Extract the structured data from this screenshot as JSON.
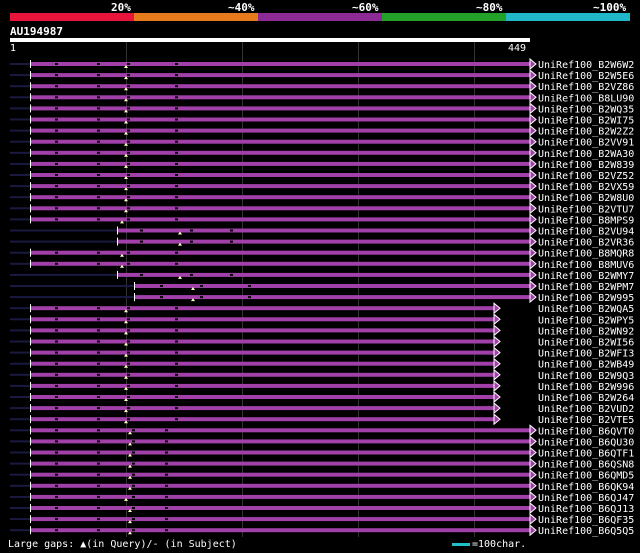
{
  "legend": [
    {
      "label": "20%",
      "color": "#e8143c"
    },
    {
      "label": "~40%",
      "color": "#e87a1e"
    },
    {
      "label": "~60%",
      "color": "#8c2a96"
    },
    {
      "label": "~80%",
      "color": "#22a02a"
    },
    {
      "label": "~100%",
      "color": "#20b8c8"
    }
  ],
  "query": {
    "title": "AU194987",
    "start": "1",
    "end": "449",
    "length": 449
  },
  "hit_color": "#a040a8",
  "gap_color": "#1a1a40",
  "hits": [
    {
      "name": "UniRef100_B2W6W2",
      "start": 30,
      "end": 530,
      "ins": [
        126
      ],
      "breaks": [
        55,
        97,
        127,
        175
      ]
    },
    {
      "name": "UniRef100_B2W5E6",
      "start": 30,
      "end": 530,
      "ins": [
        126
      ],
      "breaks": [
        55,
        97,
        127,
        175
      ]
    },
    {
      "name": "UniRef100_B2VZ86",
      "start": 30,
      "end": 530,
      "ins": [
        126
      ],
      "breaks": [
        55,
        97,
        127,
        175
      ]
    },
    {
      "name": "UniRef100_B8LU90",
      "start": 30,
      "end": 530,
      "ins": [
        126
      ],
      "breaks": [
        55,
        97,
        127,
        175
      ]
    },
    {
      "name": "UniRef100_B2WQ35",
      "start": 30,
      "end": 530,
      "ins": [
        126
      ],
      "breaks": [
        55,
        97,
        127,
        175
      ]
    },
    {
      "name": "UniRef100_B2WI75",
      "start": 30,
      "end": 530,
      "ins": [
        126
      ],
      "breaks": [
        55,
        97,
        127,
        175
      ]
    },
    {
      "name": "UniRef100_B2W2Z2",
      "start": 30,
      "end": 530,
      "ins": [
        126
      ],
      "breaks": [
        55,
        97,
        127,
        175
      ]
    },
    {
      "name": "UniRef100_B2VV91",
      "start": 30,
      "end": 530,
      "ins": [
        126
      ],
      "breaks": [
        55,
        97,
        127,
        175
      ]
    },
    {
      "name": "UniRef100_B2WA30",
      "start": 30,
      "end": 530,
      "ins": [
        126
      ],
      "breaks": [
        55,
        97,
        127,
        175
      ]
    },
    {
      "name": "UniRef100_B2W839",
      "start": 30,
      "end": 530,
      "ins": [
        126
      ],
      "breaks": [
        55,
        97,
        127,
        175
      ]
    },
    {
      "name": "UniRef100_B2VZ52",
      "start": 30,
      "end": 530,
      "ins": [
        126
      ],
      "breaks": [
        55,
        97,
        127,
        175
      ]
    },
    {
      "name": "UniRef100_B2VX59",
      "start": 30,
      "end": 530,
      "ins": [
        126
      ],
      "breaks": [
        55,
        97,
        127,
        175
      ]
    },
    {
      "name": "UniRef100_B2W8U0",
      "start": 30,
      "end": 530,
      "ins": [
        126
      ],
      "breaks": [
        55,
        97,
        127,
        175
      ]
    },
    {
      "name": "UniRef100_B2VTU7",
      "start": 30,
      "end": 530,
      "ins": [
        126
      ],
      "breaks": [
        55,
        97,
        127,
        175
      ]
    },
    {
      "name": "UniRef100_B8MPS9",
      "start": 30,
      "end": 530,
      "ins": [
        122
      ],
      "breaks": [
        55,
        97,
        127,
        175
      ]
    },
    {
      "name": "UniRef100_B2VU94",
      "start": 117,
      "end": 530,
      "ins": [
        180
      ],
      "breaks": [
        140,
        190,
        230
      ]
    },
    {
      "name": "UniRef100_B2VR36",
      "start": 117,
      "end": 530,
      "ins": [
        180
      ],
      "breaks": [
        140,
        190,
        230
      ]
    },
    {
      "name": "UniRef100_B8MQR8",
      "start": 30,
      "end": 530,
      "ins": [
        122
      ],
      "breaks": [
        55,
        97,
        127,
        175
      ]
    },
    {
      "name": "UniRef100_B8MUV6",
      "start": 30,
      "end": 530,
      "ins": [
        122
      ],
      "breaks": [
        55,
        97,
        127,
        175
      ]
    },
    {
      "name": "UniRef100_B2WMY7",
      "start": 117,
      "end": 530,
      "ins": [
        180
      ],
      "breaks": [
        140,
        190,
        230
      ]
    },
    {
      "name": "UniRef100_B2WPM7",
      "start": 134,
      "end": 530,
      "ins": [
        193
      ],
      "breaks": [
        160,
        200,
        248
      ]
    },
    {
      "name": "UniRef100_B2W995",
      "start": 134,
      "end": 530,
      "ins": [
        193
      ],
      "breaks": [
        160,
        200,
        248
      ]
    },
    {
      "name": "UniRef100_B2WQA5",
      "start": 30,
      "end": 494,
      "ins": [
        126
      ],
      "breaks": [
        55,
        97,
        127,
        175
      ]
    },
    {
      "name": "UniRef100_B2WPY5",
      "start": 30,
      "end": 494,
      "ins": [
        126
      ],
      "breaks": [
        55,
        97,
        127,
        175
      ]
    },
    {
      "name": "UniRef100_B2WN92",
      "start": 30,
      "end": 494,
      "ins": [
        126
      ],
      "breaks": [
        55,
        97,
        127,
        175
      ]
    },
    {
      "name": "UniRef100_B2WI56",
      "start": 30,
      "end": 494,
      "ins": [
        126
      ],
      "breaks": [
        55,
        97,
        127,
        175
      ]
    },
    {
      "name": "UniRef100_B2WFI3",
      "start": 30,
      "end": 494,
      "ins": [
        126
      ],
      "breaks": [
        55,
        97,
        127,
        175
      ]
    },
    {
      "name": "UniRef100_B2WB49",
      "start": 30,
      "end": 494,
      "ins": [
        126
      ],
      "breaks": [
        55,
        97,
        127,
        175
      ]
    },
    {
      "name": "UniRef100_B2W9Q3",
      "start": 30,
      "end": 494,
      "ins": [
        126
      ],
      "breaks": [
        55,
        97,
        127,
        175
      ]
    },
    {
      "name": "UniRef100_B2W996",
      "start": 30,
      "end": 494,
      "ins": [
        126
      ],
      "breaks": [
        55,
        97,
        127,
        175
      ]
    },
    {
      "name": "UniRef100_B2W264",
      "start": 30,
      "end": 494,
      "ins": [
        126
      ],
      "breaks": [
        55,
        97,
        127,
        175
      ]
    },
    {
      "name": "UniRef100_B2VUD2",
      "start": 30,
      "end": 494,
      "ins": [
        126
      ],
      "breaks": [
        55,
        97,
        127,
        175
      ]
    },
    {
      "name": "UniRef100_B2VTE5",
      "start": 30,
      "end": 494,
      "ins": [
        126
      ],
      "breaks": [
        55,
        97,
        127,
        175
      ]
    },
    {
      "name": "UniRef100_B6QVT0",
      "start": 30,
      "end": 530,
      "ins": [
        130
      ],
      "breaks": [
        55,
        97,
        132,
        165
      ]
    },
    {
      "name": "UniRef100_B6QU30",
      "start": 30,
      "end": 530,
      "ins": [
        130
      ],
      "breaks": [
        55,
        97,
        132,
        165
      ]
    },
    {
      "name": "UniRef100_B6QTF1",
      "start": 30,
      "end": 530,
      "ins": [
        130
      ],
      "breaks": [
        55,
        97,
        132,
        165
      ]
    },
    {
      "name": "UniRef100_B6QSN8",
      "start": 30,
      "end": 530,
      "ins": [
        130
      ],
      "breaks": [
        55,
        97,
        132,
        165
      ]
    },
    {
      "name": "UniRef100_B6QMD5",
      "start": 30,
      "end": 530,
      "ins": [
        130
      ],
      "breaks": [
        55,
        97,
        132,
        165
      ]
    },
    {
      "name": "UniRef100_B6QK94",
      "start": 30,
      "end": 530,
      "ins": [
        130
      ],
      "breaks": [
        55,
        97,
        132,
        165
      ]
    },
    {
      "name": "UniRef100_B6QJ47",
      "start": 30,
      "end": 530,
      "ins": [
        126
      ],
      "breaks": [
        55,
        97,
        132,
        165
      ]
    },
    {
      "name": "UniRef100_B6QJ13",
      "start": 30,
      "end": 530,
      "ins": [
        130
      ],
      "breaks": [
        55,
        97,
        132,
        165
      ]
    },
    {
      "name": "UniRef100_B6QF35",
      "start": 30,
      "end": 530,
      "ins": [
        130
      ],
      "breaks": [
        55,
        97,
        132,
        165
      ]
    },
    {
      "name": "UniRef100_B6Q5Q5",
      "start": 30,
      "end": 530,
      "ins": [
        130
      ],
      "breaks": [
        55,
        97,
        132,
        165
      ]
    }
  ],
  "footer": {
    "large_gaps": "Large gaps: ▲(in Query)/- (in Subject)",
    "scale": "=100char."
  }
}
